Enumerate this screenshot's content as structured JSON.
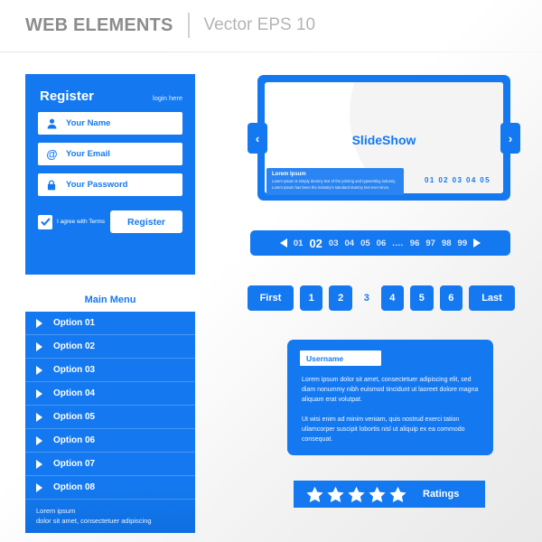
{
  "header": {
    "main_title": "WEB ELEMENTS",
    "sub_title": "Vector EPS 10"
  },
  "register": {
    "title": "Register",
    "login_link": "login here",
    "fields": [
      {
        "icon": "user-icon",
        "placeholder": "Your Name"
      },
      {
        "icon": "at-sign-icon",
        "placeholder": "Your Email"
      },
      {
        "icon": "lock-icon",
        "placeholder": "Your Password"
      }
    ],
    "terms_label": "I agree with Terms",
    "submit_label": "Register"
  },
  "menu": {
    "title": "Main Menu",
    "items": [
      {
        "label": "Option 01"
      },
      {
        "label": "Option 02"
      },
      {
        "label": "Option 03"
      },
      {
        "label": "Option 04"
      },
      {
        "label": "Option 05"
      },
      {
        "label": "Option 06"
      },
      {
        "label": "Option 07"
      },
      {
        "label": "Option 08"
      }
    ],
    "footer_line1": "Lorem ipsum",
    "footer_line2": "dolor sit amet, consectetuer adipiscing"
  },
  "slideshow": {
    "title": "SlideShow",
    "prev_icon": "chevron-left-icon",
    "next_icon": "chevron-right-icon",
    "prev_glyph": "‹",
    "next_glyph": "›",
    "caption_title": "Lorem Ipsum",
    "caption_body": "Lorem Ipsum is simply dummy text of the printing and typesetting industry. Lorem Ipsum has been the industry's standard dummy text ever since.",
    "slide_numbers": "01 02 03 04 05"
  },
  "pager": {
    "prev_icon": "triangle-left-icon",
    "next_icon": "triangle-right-icon",
    "pages": [
      {
        "label": "01",
        "active": false
      },
      {
        "label": "02",
        "active": true
      },
      {
        "label": "03",
        "active": false
      },
      {
        "label": "04",
        "active": false
      },
      {
        "label": "05",
        "active": false
      },
      {
        "label": "06",
        "active": false
      },
      {
        "label": "....",
        "active": false
      },
      {
        "label": "96",
        "active": false
      },
      {
        "label": "97",
        "active": false
      },
      {
        "label": "98",
        "active": false
      },
      {
        "label": "99",
        "active": false
      }
    ]
  },
  "pagination": {
    "first_label": "First",
    "last_label": "Last",
    "numbers": [
      {
        "label": "1",
        "current": false
      },
      {
        "label": "2",
        "current": false
      },
      {
        "label": "3",
        "current": true
      },
      {
        "label": "4",
        "current": false
      },
      {
        "label": "5",
        "current": false
      },
      {
        "label": "6",
        "current": false
      }
    ]
  },
  "comment": {
    "username_value": "Username",
    "paragraph1": "Lorem ipsum dolor sit amet, consectetuer adipiscing elit, sed diam nonummy nibh euismod tincidunt ut laoreet dolore magna aliquam erat volutpat.",
    "paragraph2": " Ut wisi enim ad minim veniam, quis nostrud exerci tation ullamcorper suscipit lobortis nisl ut aliquip ex ea commodo consequat."
  },
  "ratings": {
    "label": "Ratings",
    "star_icon": "star-icon",
    "star_count": 5
  },
  "colors": {
    "brand_blue": "#1479f0",
    "caption_blue": "#2a85f2",
    "header_gray": "#8c8c8c",
    "header_sub_gray": "#b4b4b4",
    "white": "#ffffff"
  }
}
